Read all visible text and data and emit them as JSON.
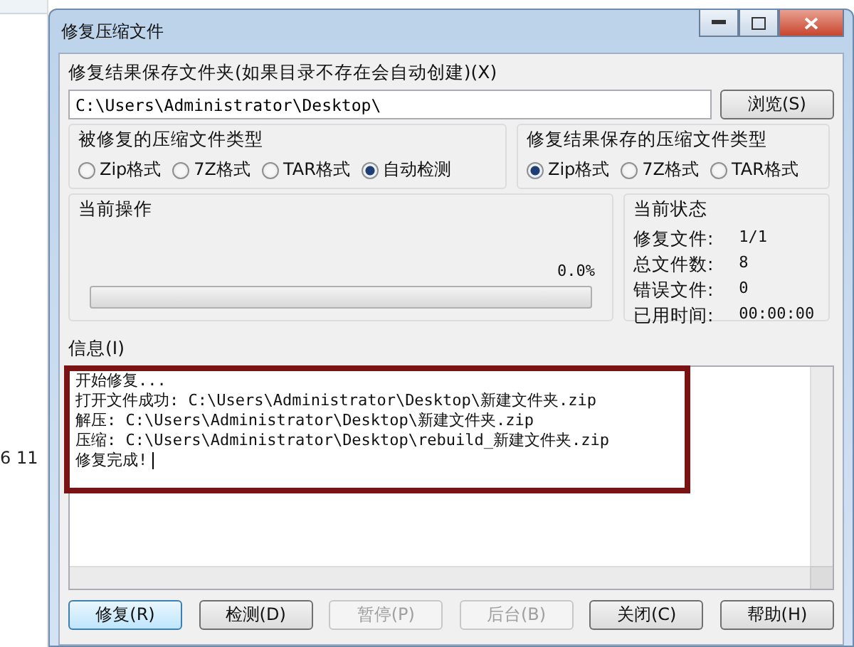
{
  "background": {
    "side_text": "6 11"
  },
  "window": {
    "title": "修复压缩文件"
  },
  "output_folder": {
    "label": "修复结果保存文件夹(如果目录不存在会自动创建)(X)",
    "value": "C:\\Users\\Administrator\\Desktop\\",
    "browse": "浏览(S)"
  },
  "source_type": {
    "title": "被修复的压缩文件类型",
    "options": [
      {
        "label": "Zip格式",
        "selected": false
      },
      {
        "label": "7Z格式",
        "selected": false
      },
      {
        "label": "TAR格式",
        "selected": false
      },
      {
        "label": "自动检测",
        "selected": true
      }
    ]
  },
  "result_type": {
    "title": "修复结果保存的压缩文件类型",
    "options": [
      {
        "label": "Zip格式",
        "selected": true
      },
      {
        "label": "7Z格式",
        "selected": false
      },
      {
        "label": "TAR格式",
        "selected": false
      }
    ]
  },
  "current_operation": {
    "title": "当前操作",
    "percent": "0.0%",
    "level": 0
  },
  "current_status": {
    "title": "当前状态",
    "rows": [
      {
        "label": "修复文件:",
        "value": "1/1"
      },
      {
        "label": "总文件数:",
        "value": "8"
      },
      {
        "label": "错误文件:",
        "value": "0"
      },
      {
        "label": "已用时间:",
        "value": "00:00:00"
      }
    ]
  },
  "info": {
    "label": "信息(I)",
    "lines": [
      "开始修复...",
      "打开文件成功: C:\\Users\\Administrator\\Desktop\\新建文件夹.zip",
      "解压: C:\\Users\\Administrator\\Desktop\\新建文件夹.zip",
      "压缩: C:\\Users\\Administrator\\Desktop\\rebuild_新建文件夹.zip",
      "修复完成!"
    ],
    "highlighted": true
  },
  "buttons": [
    {
      "label": "修复(R)",
      "disabled": false,
      "default": true
    },
    {
      "label": "检测(D)",
      "disabled": false,
      "default": false
    },
    {
      "label": "暂停(P)",
      "disabled": true,
      "default": false
    },
    {
      "label": "后台(B)",
      "disabled": true,
      "default": false
    },
    {
      "label": "关闭(C)",
      "disabled": false,
      "default": false
    },
    {
      "label": "帮助(H)",
      "disabled": false,
      "default": false
    }
  ]
}
